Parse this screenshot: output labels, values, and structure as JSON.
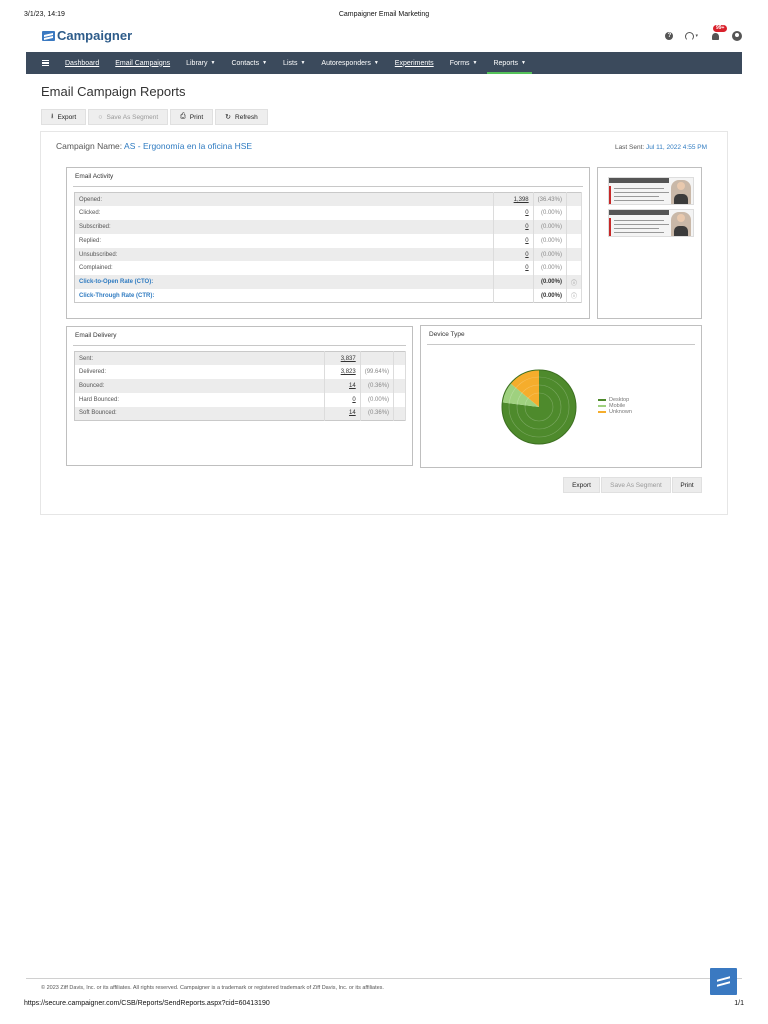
{
  "print": {
    "datetime": "3/1/23, 14:19",
    "title": "Campaigner Email Marketing",
    "url": "https://secure.campaigner.com/CSB/Reports/SendReports.aspx?cid=60413190",
    "page": "1/1"
  },
  "brand": {
    "name": "Campaigner"
  },
  "header": {
    "notification_badge": "99+"
  },
  "nav": {
    "items": [
      {
        "label": "Dashboard"
      },
      {
        "label": "Email Campaigns"
      },
      {
        "label": "Library"
      },
      {
        "label": "Contacts"
      },
      {
        "label": "Lists"
      },
      {
        "label": "Autoresponders"
      },
      {
        "label": "Experiments"
      },
      {
        "label": "Forms"
      },
      {
        "label": "Reports"
      }
    ]
  },
  "page": {
    "title": "Email Campaign Reports"
  },
  "toolbar": {
    "export": "Export",
    "save_segment": "Save As Segment",
    "print": "Print",
    "refresh": "Refresh"
  },
  "campaign": {
    "name_label": "Campaign Name:",
    "name": "AS - Ergonomía en la oficina HSE",
    "last_sent_label": "Last Sent:",
    "last_sent": "Jul 11, 2022 4:55 PM"
  },
  "email_activity": {
    "title": "Email Activity",
    "rows": [
      {
        "label": "Opened:",
        "value": "1,398",
        "pct": "(36.43%)"
      },
      {
        "label": "Clicked:",
        "value": "0",
        "pct": "(0.00%)"
      },
      {
        "label": "Subscribed:",
        "value": "0",
        "pct": "(0.00%)"
      },
      {
        "label": "Replied:",
        "value": "0",
        "pct": "(0.00%)"
      },
      {
        "label": "Unsubscribed:",
        "value": "0",
        "pct": "(0.00%)"
      },
      {
        "label": "Complained:",
        "value": "0",
        "pct": "(0.00%)"
      }
    ],
    "rates": [
      {
        "label": "Click-to-Open Rate (CTO):",
        "pct": "(0.00%)"
      },
      {
        "label": "Click-Through Rate (CTR):",
        "pct": "(0.00%)"
      }
    ]
  },
  "email_delivery": {
    "title": "Email Delivery",
    "rows": [
      {
        "label": "Sent:",
        "value": "3,837",
        "pct": ""
      },
      {
        "label": "Delivered:",
        "value": "3,823",
        "pct": "(99.64%)"
      },
      {
        "label": "Bounced:",
        "value": "14",
        "pct": "(0.36%)"
      },
      {
        "label": "Hard Bounced:",
        "value": "0",
        "pct": "(0.00%)"
      },
      {
        "label": "Soft Bounced:",
        "value": "14",
        "pct": "(0.36%)"
      }
    ]
  },
  "device_type": {
    "title": "Device Type"
  },
  "chart_data": {
    "type": "pie",
    "title": "Device Type",
    "categories": [
      "Desktop",
      "Mobile",
      "Unknown"
    ],
    "values": [
      77,
      9,
      14
    ],
    "colors": [
      "#4e8a2c",
      "#9fd17f",
      "#f5ad2c"
    ],
    "legend_position": "right"
  },
  "bottom_buttons": {
    "export": "Export",
    "save_segment": "Save As Segment",
    "print": "Print"
  },
  "footer": {
    "copyright": "© 2023 Ziff Davis, Inc. or its affiliates. All rights reserved. Campaigner is a trademark or registered trademark of Ziff Davis, Inc. or its affiliates."
  },
  "icons": {
    "help": "help-icon",
    "support": "headset-icon",
    "notifications": "bell-icon",
    "account": "user-icon",
    "chat": "chat-icon"
  }
}
